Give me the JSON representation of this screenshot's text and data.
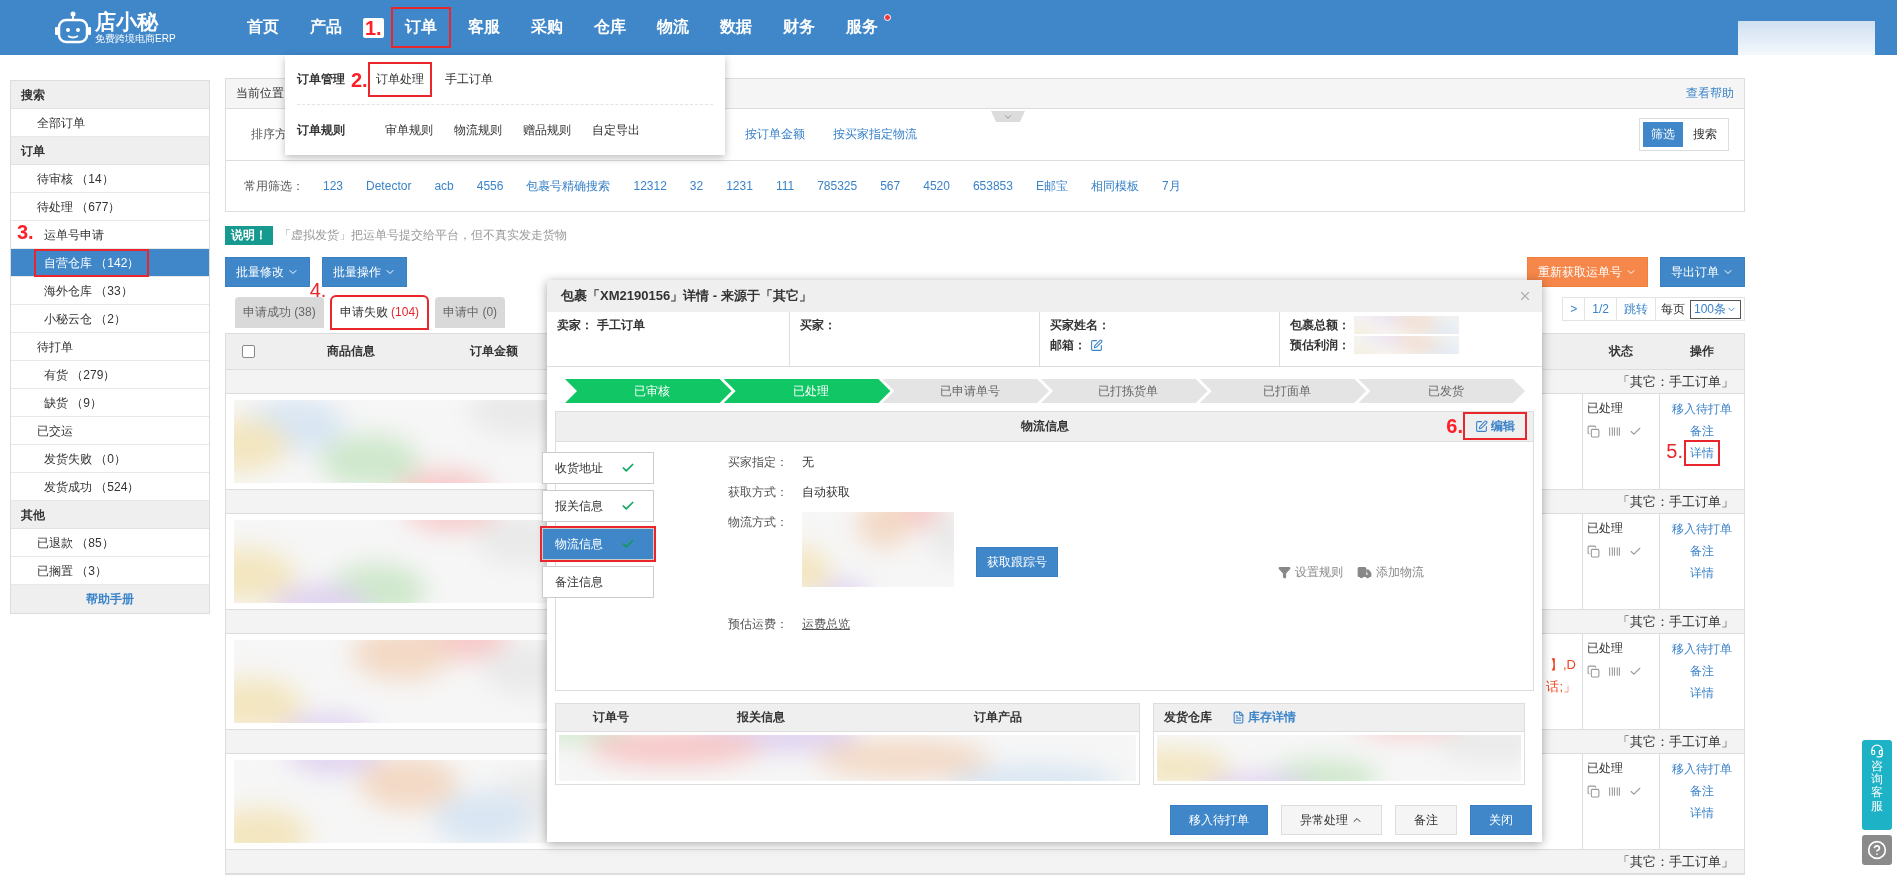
{
  "logo": {
    "name": "店小秘",
    "tagline": "免费跨境电商ERP"
  },
  "nav": [
    {
      "label": "首页",
      "dot": false
    },
    {
      "label": "产品",
      "dot": false
    },
    {
      "label": "订单",
      "dot": false,
      "callout": "1."
    },
    {
      "label": "客服",
      "dot": false
    },
    {
      "label": "采购",
      "dot": false
    },
    {
      "label": "仓库",
      "dot": false
    },
    {
      "label": "物流",
      "dot": false
    },
    {
      "label": "数据",
      "dot": false
    },
    {
      "label": "财务",
      "dot": false
    },
    {
      "label": "服务",
      "dot": true
    }
  ],
  "nav_menu": [
    {
      "title": "订单管理",
      "items": [
        {
          "label": "订单处理",
          "callout": "2."
        },
        {
          "label": "手工订单"
        }
      ]
    },
    {
      "title": "订单规则",
      "items": [
        {
          "label": "审单规则"
        },
        {
          "label": "物流规则"
        },
        {
          "label": "赠品规则"
        },
        {
          "label": "自定导出"
        }
      ]
    }
  ],
  "sidebar": {
    "sections": [
      {
        "title": "搜索",
        "items": [
          {
            "label": "全部订单",
            "selected": false
          }
        ]
      },
      {
        "title": "订单",
        "items": [
          {
            "label": "待审核 （14）",
            "selected": false
          },
          {
            "label": "待处理 （677）",
            "selected": false
          },
          {
            "label": "运单号申请",
            "selected": false,
            "children": [
              {
                "label": "自营仓库 （142）",
                "selected": true,
                "callout": "3."
              },
              {
                "label": "海外仓库 （33）",
                "selected": false
              },
              {
                "label": "小秘云仓 （2）",
                "selected": false
              }
            ]
          },
          {
            "label": "待打单",
            "selected": false,
            "children": [
              {
                "label": "有货 （279）",
                "selected": false
              },
              {
                "label": "缺货 （9）",
                "selected": false
              }
            ]
          },
          {
            "label": "已交运",
            "selected": false,
            "children": [
              {
                "label": "发货失败 （0）",
                "selected": false
              },
              {
                "label": "发货成功 （524）",
                "selected": false
              }
            ]
          }
        ]
      },
      {
        "title": "其他",
        "items": [
          {
            "label": "已退款 （85）",
            "selected": false
          },
          {
            "label": "已搁置 （3）",
            "selected": false
          }
        ]
      }
    ],
    "help": "帮助手册"
  },
  "breadcrumb": {
    "label": "当前位置",
    "help": "查看帮助"
  },
  "sort": {
    "label": "排序方",
    "options": [
      "按订单金额",
      "按买家指定物流"
    ]
  },
  "view_toggle": [
    {
      "label": "筛选",
      "selected": true
    },
    {
      "label": "搜索",
      "selected": false
    }
  ],
  "quick_filters": {
    "label": "常用筛选：",
    "items": [
      "123",
      "Detector",
      "acb",
      "4556",
      "包裹号精确搜索",
      "12312",
      "32",
      "1231",
      "111",
      "785325",
      "567",
      "4520",
      "653853",
      "E邮宝",
      "相同模板",
      "7月"
    ]
  },
  "notice": {
    "badge": "说明！",
    "text": "「虚拟发货」把运单号提交给平台，但不真实发走货物"
  },
  "actions": {
    "left": [
      "批量修改",
      "批量操作"
    ],
    "right": [
      {
        "label": "重新获取运单号",
        "kind": "warning"
      },
      {
        "label": "导出订单",
        "kind": "primary"
      }
    ]
  },
  "tabs": [
    {
      "label": "申请成功",
      "count": "(38)",
      "selected": false
    },
    {
      "label": "申请失败",
      "count": "(104)",
      "selected": true,
      "callout": "4."
    },
    {
      "label": "申请中",
      "count": "(0)",
      "selected": false
    }
  ],
  "pagination": {
    "next": ">",
    "page": "1/2",
    "jump": "跳转",
    "per_page_label": "每页",
    "per_page": "100条"
  },
  "table": {
    "select_all": {
      "checked": false
    },
    "columns": {
      "product": "商品信息",
      "amount": "订单金额",
      "status": "状态",
      "actions": "操作"
    },
    "groups": [
      {
        "source": "「其它：手工订单」",
        "order": {
          "status": "已处理",
          "actions": [
            {
              "label": "移入待打单"
            },
            {
              "label": "备注"
            },
            {
              "label": "详情",
              "callout": "5."
            }
          ]
        }
      },
      {
        "source": "「其它：手工订单」",
        "order": {
          "status": "已处理",
          "actions": [
            {
              "label": "移入待打单"
            },
            {
              "label": "备注"
            },
            {
              "label": "详情"
            }
          ]
        }
      },
      {
        "source": "「其它：手工订单」",
        "order": {
          "status": "已处理",
          "note": [
            "】,D",
            "话;」"
          ],
          "actions": [
            {
              "label": "移入待打单"
            },
            {
              "label": "备注"
            },
            {
              "label": "详情"
            }
          ]
        }
      },
      {
        "source": "「其它：手工订单」",
        "order": {
          "status": "已处理",
          "actions": [
            {
              "label": "移入待打单"
            },
            {
              "label": "备注"
            },
            {
              "label": "详情"
            }
          ]
        }
      },
      {
        "source": "「其它：手工订单」"
      }
    ]
  },
  "package_detail": {
    "title": "包裹「XM2190156」详情 - 来源于「其它」",
    "info": [
      [
        {
          "label": "卖家：",
          "kind": "text",
          "value": "手工订单"
        }
      ],
      [
        {
          "label": "买家：",
          "kind": "empty"
        }
      ],
      [
        {
          "label": "买家姓名：",
          "kind": "empty"
        },
        {
          "label": "邮箱：",
          "kind": "edit"
        }
      ],
      [
        {
          "label": "包裹总额：",
          "kind": "blurred"
        },
        {
          "label": "预估利润：",
          "kind": "blurred"
        }
      ]
    ],
    "steps": [
      {
        "label": "已审核",
        "done": true
      },
      {
        "label": "已处理",
        "done": true
      },
      {
        "label": "已申请单号",
        "done": false
      },
      {
        "label": "已打拣货单",
        "done": false
      },
      {
        "label": "已打面单",
        "done": false
      },
      {
        "label": "已发货",
        "done": false
      }
    ],
    "logistics": {
      "title": "物流信息",
      "edit": {
        "label": "编辑",
        "callout": "6."
      },
      "tabs": [
        {
          "label": "收货地址",
          "checked": true,
          "selected": false,
          "boxed": false
        },
        {
          "label": "报关信息",
          "checked": true,
          "selected": false,
          "boxed": false
        },
        {
          "label": "物流信息",
          "checked": true,
          "selected": true,
          "boxed": true
        },
        {
          "label": "备注信息",
          "checked": false,
          "selected": false,
          "boxed": false
        }
      ],
      "fields": [
        {
          "label": "买家指定：",
          "kind": "text",
          "value": "无"
        },
        {
          "label": "获取方式：",
          "kind": "text",
          "value": "自动获取"
        },
        {
          "label": "物流方式：",
          "kind": "blurred",
          "button": "获取跟踪号"
        },
        {
          "label": "预估运费：",
          "kind": "link",
          "value": "运费总览"
        }
      ],
      "tools": [
        {
          "label": "设置规则",
          "kind": "filter"
        },
        {
          "label": "添加物流",
          "kind": "truck"
        }
      ]
    },
    "order_columns": [
      "订单号",
      "报关信息",
      "订单产品"
    ],
    "warehouse": {
      "label": "发货仓库",
      "link": "库存详情"
    },
    "buttons": [
      {
        "label": "移入待打单",
        "kind": "primary"
      },
      {
        "label": "异常处理",
        "kind": "menu"
      },
      {
        "label": "备注",
        "kind": "default"
      },
      {
        "label": "关闭",
        "kind": "primary"
      }
    ]
  },
  "service": {
    "label": "咨询客服"
  }
}
